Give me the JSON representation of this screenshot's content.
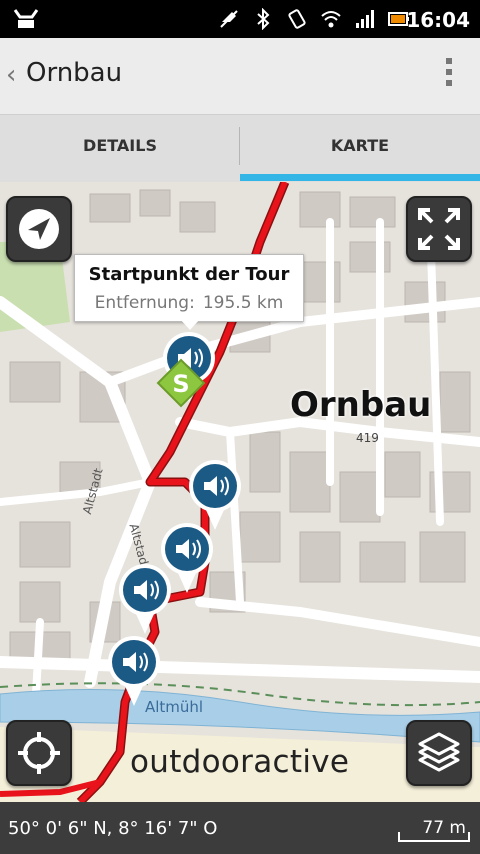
{
  "status_bar": {
    "time": "16:04"
  },
  "action_bar": {
    "title": "Ornbau"
  },
  "tabs": [
    {
      "label": "DETAILS",
      "selected": false
    },
    {
      "label": "KARTE",
      "selected": true
    }
  ],
  "map": {
    "place_label": "Ornbau",
    "elevation_label": "419",
    "street_labels": [
      "Altstadt",
      "Altstadt",
      "Altmühl"
    ],
    "callout": {
      "title": "Startpunkt der Tour",
      "distance_label": "Entfernung:",
      "distance_value": "195.5 km"
    },
    "start_marker_letter": "S",
    "brand": "outdooractive",
    "audio_markers": 5
  },
  "coord_bar": {
    "coordinates": "50° 0' 6\" N, 8° 16' 7\" O",
    "scale": "77 m"
  },
  "colors": {
    "accent": "#33b5e5",
    "route": "#e8131b",
    "start_marker": "#8dc63f",
    "audio_marker": "#1c5a86",
    "river": "#a9cfe8"
  }
}
